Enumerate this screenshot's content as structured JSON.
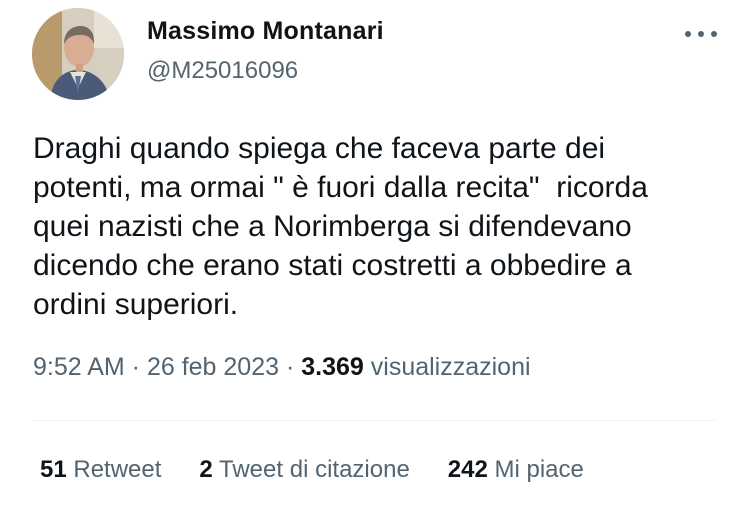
{
  "author": {
    "name": "Massimo Montanari",
    "handle": "@M25016096",
    "avatar_icon": "profile-photo"
  },
  "more_icon": "ellipsis-icon",
  "tweet": {
    "text": "Draghi quando spiega che faceva parte dei\npotenti, ma ormai \" è fuori dalla recita\"  ricorda\nquei nazisti che a Norimberga si difendevano\ndicendo che erano stati costretti a obbedire a\nordini superiori."
  },
  "meta": {
    "time": "9:52 AM",
    "separator1": " · ",
    "date": "26 feb 2023",
    "separator2": " · ",
    "views_count": "3.369",
    "views_label": " visualizzazioni"
  },
  "stats": {
    "retweets_count": "51",
    "retweets_label": " Retweet",
    "quotes_count": "2",
    "quotes_label": " Tweet di citazione",
    "likes_count": "242",
    "likes_label": " Mi piace"
  },
  "colors": {
    "text_primary": "#0f1419",
    "text_secondary": "#536471",
    "divider": "#eff3f4",
    "background": "#ffffff"
  }
}
